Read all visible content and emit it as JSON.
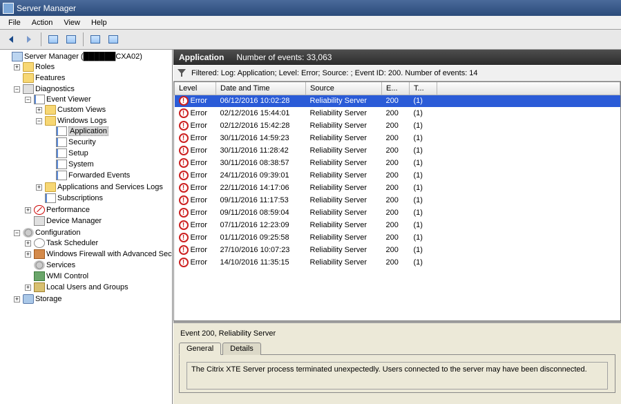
{
  "window": {
    "title": "Server Manager"
  },
  "menu": {
    "file": "File",
    "action": "Action",
    "view": "View",
    "help": "Help"
  },
  "tree": {
    "root": "Server Manager (██████CXA02)",
    "roles": "Roles",
    "features": "Features",
    "diagnostics": "Diagnostics",
    "event_viewer": "Event Viewer",
    "custom_views": "Custom Views",
    "windows_logs": "Windows Logs",
    "application": "Application",
    "security": "Security",
    "setup": "Setup",
    "system": "System",
    "forwarded": "Forwarded Events",
    "app_svc_logs": "Applications and Services Logs",
    "subscriptions": "Subscriptions",
    "performance": "Performance",
    "device_manager": "Device Manager",
    "configuration": "Configuration",
    "task_scheduler": "Task Scheduler",
    "firewall": "Windows Firewall with Advanced Secu",
    "services": "Services",
    "wmi": "WMI Control",
    "local_users": "Local Users and Groups",
    "storage": "Storage"
  },
  "header": {
    "title": "Application",
    "count_label": "Number of events: 33,063"
  },
  "filter": {
    "text": "Filtered: Log: Application; Level: Error; Source: ; Event ID: 200. Number of events: 14"
  },
  "columns": {
    "level": "Level",
    "date": "Date and Time",
    "source": "Source",
    "eid": "E...",
    "task": "T..."
  },
  "events": [
    {
      "level": "Error",
      "date": "06/12/2016 10:02:28",
      "source": "Reliability Server",
      "eid": "200",
      "task": "(1)",
      "selected": true
    },
    {
      "level": "Error",
      "date": "02/12/2016 15:44:01",
      "source": "Reliability Server",
      "eid": "200",
      "task": "(1)"
    },
    {
      "level": "Error",
      "date": "02/12/2016 15:42:28",
      "source": "Reliability Server",
      "eid": "200",
      "task": "(1)"
    },
    {
      "level": "Error",
      "date": "30/11/2016 14:59:23",
      "source": "Reliability Server",
      "eid": "200",
      "task": "(1)"
    },
    {
      "level": "Error",
      "date": "30/11/2016 11:28:42",
      "source": "Reliability Server",
      "eid": "200",
      "task": "(1)"
    },
    {
      "level": "Error",
      "date": "30/11/2016 08:38:57",
      "source": "Reliability Server",
      "eid": "200",
      "task": "(1)"
    },
    {
      "level": "Error",
      "date": "24/11/2016 09:39:01",
      "source": "Reliability Server",
      "eid": "200",
      "task": "(1)"
    },
    {
      "level": "Error",
      "date": "22/11/2016 14:17:06",
      "source": "Reliability Server",
      "eid": "200",
      "task": "(1)"
    },
    {
      "level": "Error",
      "date": "09/11/2016 11:17:53",
      "source": "Reliability Server",
      "eid": "200",
      "task": "(1)"
    },
    {
      "level": "Error",
      "date": "09/11/2016 08:59:04",
      "source": "Reliability Server",
      "eid": "200",
      "task": "(1)"
    },
    {
      "level": "Error",
      "date": "07/11/2016 12:23:09",
      "source": "Reliability Server",
      "eid": "200",
      "task": "(1)"
    },
    {
      "level": "Error",
      "date": "01/11/2016 09:25:58",
      "source": "Reliability Server",
      "eid": "200",
      "task": "(1)"
    },
    {
      "level": "Error",
      "date": "27/10/2016 10:07:23",
      "source": "Reliability Server",
      "eid": "200",
      "task": "(1)"
    },
    {
      "level": "Error",
      "date": "14/10/2016 11:35:15",
      "source": "Reliability Server",
      "eid": "200",
      "task": "(1)"
    }
  ],
  "details": {
    "title": "Event 200, Reliability Server",
    "tab_general": "General",
    "tab_details": "Details",
    "message": "The Citrix XTE Server process terminated unexpectedly. Users connected to the server may have been disconnected."
  }
}
